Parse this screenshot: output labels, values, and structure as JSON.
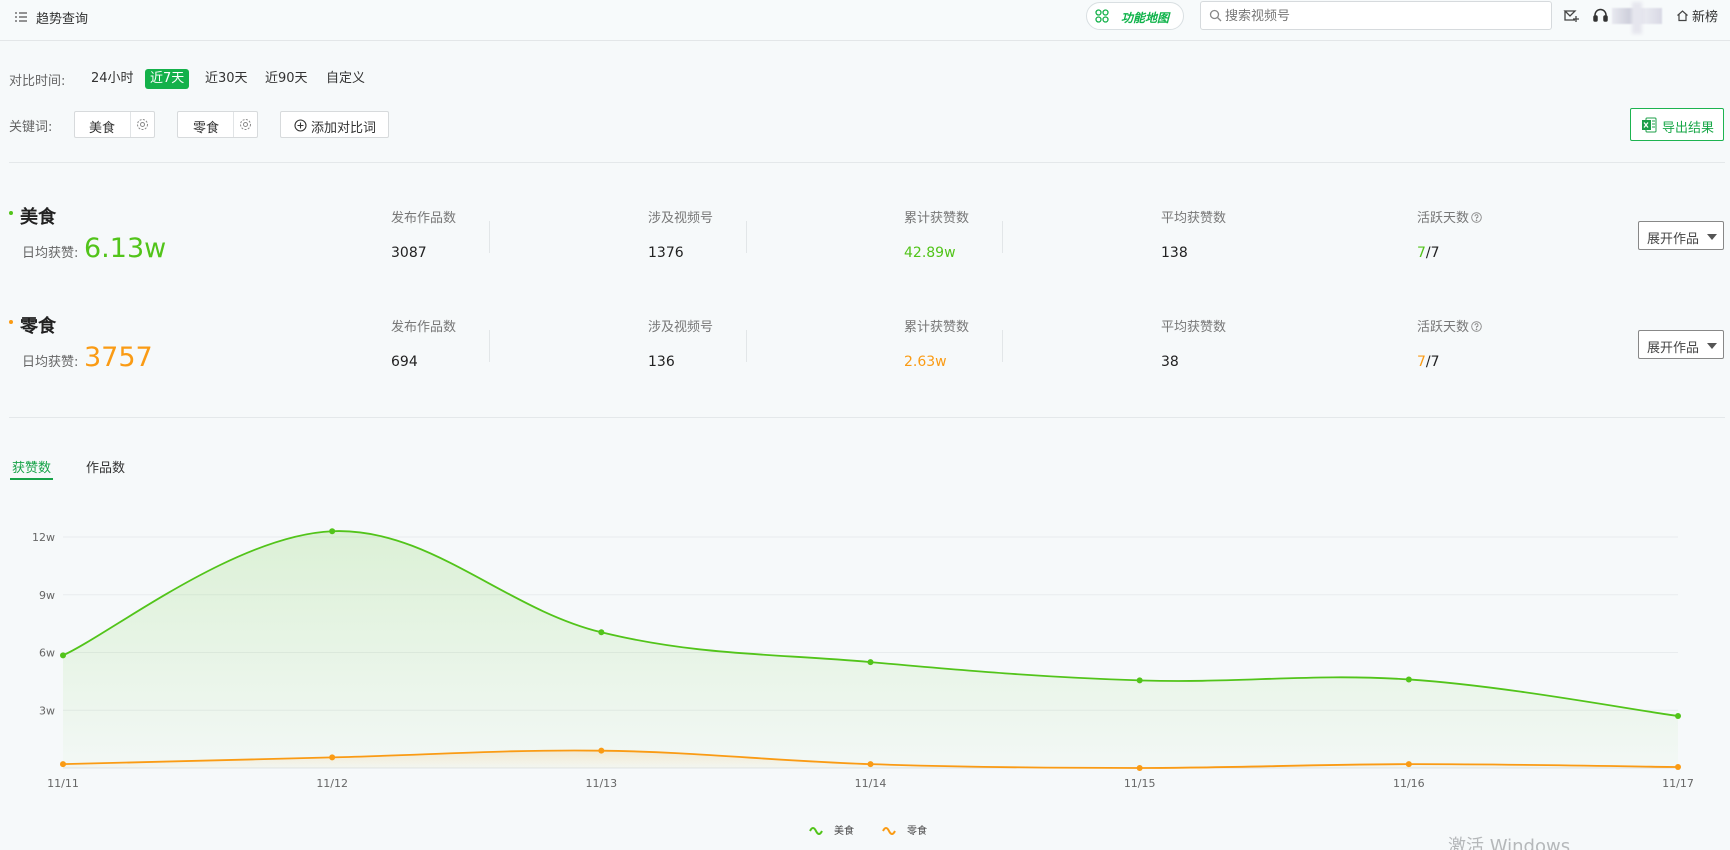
{
  "header": {
    "title": "趋势查询",
    "func_map_label": "功能地图",
    "search_placeholder": "搜索视频号",
    "new_list_label": "新榜"
  },
  "filters": {
    "time_label": "对比时间:",
    "time_options": [
      {
        "label": "24小时",
        "active": false
      },
      {
        "label": "近7天",
        "active": true
      },
      {
        "label": "近30天",
        "active": false
      },
      {
        "label": "近90天",
        "active": false
      },
      {
        "label": "自定义",
        "active": false
      }
    ],
    "keyword_label": "关键词:",
    "keywords": [
      "美食",
      "零食"
    ],
    "add_label": "添加对比词",
    "export_label": "导出结果"
  },
  "stats": [
    {
      "name": "美食",
      "color": "#52c41a",
      "avg_label": "日均获赞:",
      "avg_value": "6.13w",
      "labels": [
        "发布作品数",
        "涉及视频号",
        "累计获赞数",
        "平均获赞数",
        "活跃天数"
      ],
      "values": [
        "3087",
        "1376",
        "42.89w",
        "138"
      ],
      "active_days": "7",
      "active_total": "/7",
      "expand_label": "展开作品"
    },
    {
      "name": "零食",
      "color": "#fa9b14",
      "avg_label": "日均获赞:",
      "avg_value": "3757",
      "labels": [
        "发布作品数",
        "涉及视频号",
        "累计获赞数",
        "平均获赞数",
        "活跃天数"
      ],
      "values": [
        "694",
        "136",
        "2.63w",
        "38"
      ],
      "active_days": "7",
      "active_total": "/7",
      "expand_label": "展开作品"
    }
  ],
  "tabs": [
    {
      "label": "获赞数",
      "active": true
    },
    {
      "label": "作品数",
      "active": false
    }
  ],
  "chart_data": {
    "type": "line",
    "categories": [
      "11/11",
      "11/12",
      "11/13",
      "11/14",
      "11/15",
      "11/16",
      "11/17"
    ],
    "y_ticks": [
      "3w",
      "6w",
      "9w",
      "12w"
    ],
    "ylim": [
      0,
      120000
    ],
    "y_tick_values": [
      30000,
      60000,
      90000,
      120000
    ],
    "grid": true,
    "legend_position": "bottom-center",
    "series": [
      {
        "name": "美食",
        "color": "#52c41a",
        "values": [
          58500,
          123000,
          70500,
          55000,
          45500,
          46000,
          27000
        ]
      },
      {
        "name": "零食",
        "color": "#fa9b14",
        "values": [
          2000,
          5500,
          9000,
          2000,
          0,
          2000,
          500
        ]
      }
    ]
  },
  "watermark": "激活 Windows"
}
